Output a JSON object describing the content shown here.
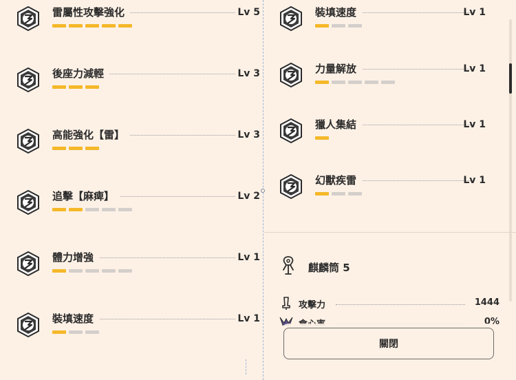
{
  "colors": {
    "background": "#fdf1e6",
    "level_on": "#f5b829",
    "level_off": "#d4cfcb",
    "text": "#2b2b2b"
  },
  "left_skills": [
    {
      "name": "雷屬性攻擊強化",
      "level": "Lv 5",
      "level_value": 5,
      "max_level": 5,
      "icon": "skill-emblem-icon"
    },
    {
      "name": "後座力減輕",
      "level": "Lv 3",
      "level_value": 3,
      "max_level": 3,
      "icon": "skill-emblem-icon"
    },
    {
      "name": "高能強化【雷】",
      "level": "Lv 3",
      "level_value": 3,
      "max_level": 3,
      "icon": "skill-emblem-icon"
    },
    {
      "name": "追擊【麻痺】",
      "level": "Lv 2",
      "level_value": 2,
      "max_level": 5,
      "icon": "skill-emblem-icon"
    },
    {
      "name": "體力增強",
      "level": "Lv 1",
      "level_value": 1,
      "max_level": 5,
      "icon": "skill-emblem-icon"
    },
    {
      "name": "裝填速度",
      "level": "Lv 1",
      "level_value": 1,
      "max_level": 3,
      "icon": "skill-emblem-icon"
    }
  ],
  "right_skills": [
    {
      "name": "裝填速度",
      "level": "Lv 1",
      "level_value": 1,
      "max_level": 3,
      "icon": "skill-emblem-icon"
    },
    {
      "name": "力量解放",
      "level": "Lv 1",
      "level_value": 1,
      "max_level": 5,
      "icon": "skill-emblem-icon"
    },
    {
      "name": "獵人集結",
      "level": "Lv 1",
      "level_value": 1,
      "max_level": 1,
      "icon": "skill-emblem-icon"
    },
    {
      "name": "幻獸疾雷",
      "level": "Lv 1",
      "level_value": 1,
      "max_level": 3,
      "icon": "skill-emblem-icon"
    }
  ],
  "weapon": {
    "name": "麒麟筒 5",
    "icon": "bowgun-icon"
  },
  "stats": [
    {
      "label": "攻擊力",
      "value": "1444",
      "icon": "attack-icon"
    },
    {
      "label": "會心率",
      "value": "0%",
      "icon": "affinity-icon"
    }
  ],
  "close_button": {
    "label": "關閉"
  }
}
